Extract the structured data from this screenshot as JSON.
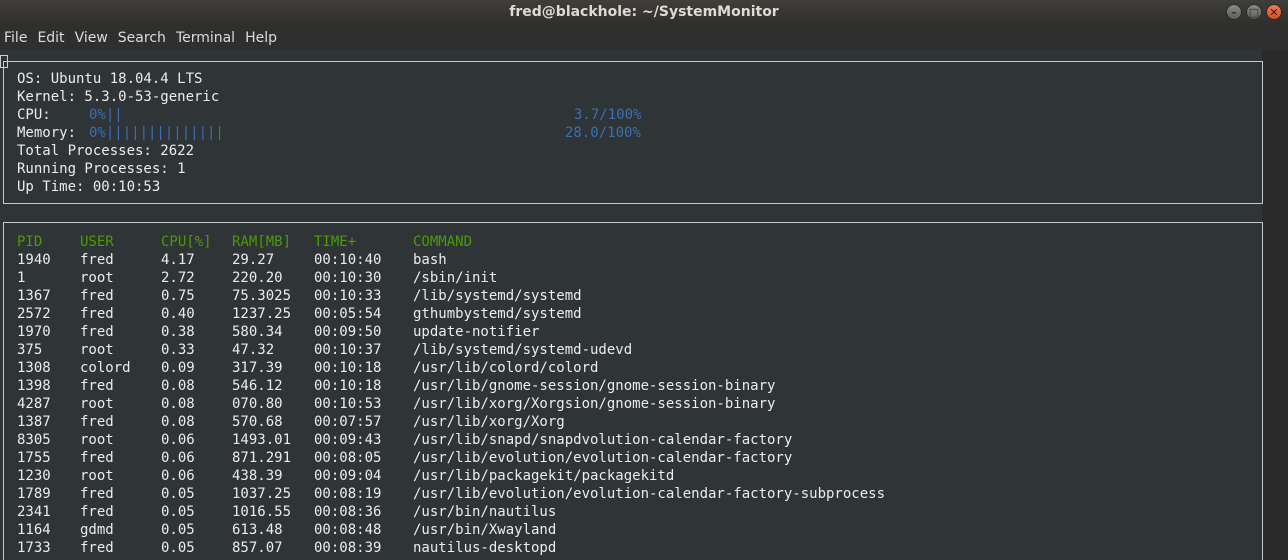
{
  "window": {
    "title": "fred@blackhole: ~/SystemMonitor"
  },
  "menu": [
    "File",
    "Edit",
    "View",
    "Search",
    "Terminal",
    "Help"
  ],
  "system": {
    "os": "OS: Ubuntu 18.04.4 LTS",
    "kernel": "Kernel: 5.3.0-53-generic",
    "cpu_label": "CPU:",
    "cpu_bar": "0%||",
    "cpu_pct": "3.7/100%",
    "cpu_value": 0.037,
    "mem_label": "Memory:",
    "mem_bar": "0%||||||||||||||",
    "mem_pct": "28.0/100%",
    "mem_value": 0.28,
    "total": "Total Processes: 2622",
    "running": "Running Processes: 1",
    "uptime": "Up Time: 00:10:53"
  },
  "process_table": {
    "columns": [
      "PID",
      "USER",
      "CPU[%]",
      "RAM[MB]",
      "TIME+",
      "COMMAND"
    ],
    "rows": [
      [
        "1940",
        "fred",
        "4.17",
        "29.27",
        "00:10:40",
        "bash"
      ],
      [
        "1",
        "root",
        "2.72",
        "220.20",
        "00:10:30",
        "/sbin/init"
      ],
      [
        "1367",
        "fred",
        "0.75",
        "75.3025",
        "00:10:33",
        "/lib/systemd/systemd"
      ],
      [
        "2572",
        "fred",
        "0.40",
        "1237.25",
        "00:05:54",
        "gthumbystemd/systemd"
      ],
      [
        "1970",
        "fred",
        "0.38",
        "580.34",
        "00:09:50",
        "update-notifier"
      ],
      [
        "375",
        "root",
        "0.33",
        "47.32",
        "00:10:37",
        "/lib/systemd/systemd-udevd"
      ],
      [
        "1308",
        "colord",
        "0.09",
        "317.39",
        "00:10:18",
        "/usr/lib/colord/colord"
      ],
      [
        "1398",
        "fred",
        "0.08",
        "546.12",
        "00:10:18",
        "/usr/lib/gnome-session/gnome-session-binary"
      ],
      [
        "4287",
        "root",
        "0.08",
        "070.80",
        "00:10:53",
        "/usr/lib/xorg/Xorgsion/gnome-session-binary"
      ],
      [
        "1387",
        "fred",
        "0.08",
        "570.68",
        "00:07:57",
        "/usr/lib/xorg/Xorg"
      ],
      [
        "8305",
        "root",
        "0.06",
        "1493.01",
        "00:09:43",
        "/usr/lib/snapd/snapdvolution-calendar-factory"
      ],
      [
        "1755",
        "fred",
        "0.06",
        "871.291",
        "00:08:05",
        "/usr/lib/evolution/evolution-calendar-factory"
      ],
      [
        "1230",
        "root",
        "0.06",
        "438.39",
        "00:09:04",
        "/usr/lib/packagekit/packagekitd"
      ],
      [
        "1789",
        "fred",
        "0.05",
        "1037.25",
        "00:08:19",
        "/usr/lib/evolution/evolution-calendar-factory-subprocess"
      ],
      [
        "2341",
        "fred",
        "0.05",
        "1016.55",
        "00:08:36",
        "/usr/bin/nautilus"
      ],
      [
        "1164",
        "gdmd",
        "0.05",
        "613.48",
        "00:08:48",
        "/usr/bin/Xwayland"
      ],
      [
        "1733",
        "fred",
        "0.05",
        "857.07",
        "00:08:39",
        "nautilus-desktopd"
      ]
    ]
  }
}
